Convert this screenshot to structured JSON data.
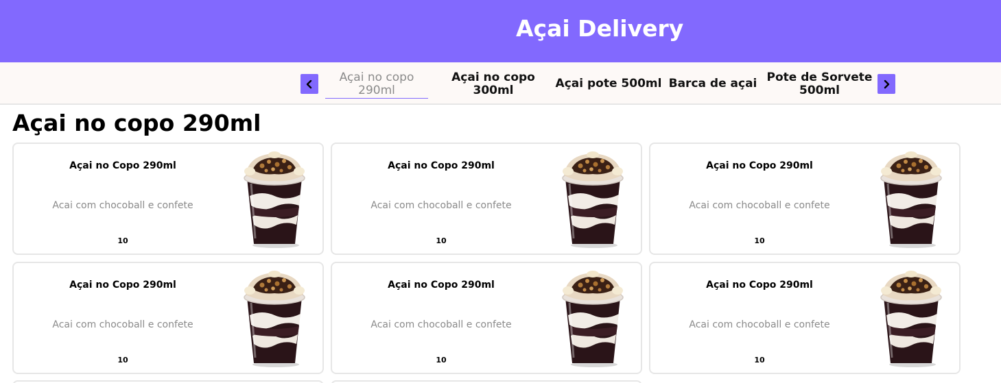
{
  "header": {
    "title": "Açai Delivery"
  },
  "colors": {
    "brand": "#8269fe",
    "muted_text": "#8a8a8a",
    "border": "#e6e6e6"
  },
  "categories": {
    "prev_icon": "chevron-left-icon",
    "next_icon": "chevron-right-icon",
    "tabs": [
      {
        "line1": "Açai no copo",
        "line2": "290ml",
        "active": true
      },
      {
        "line1": "Açai no copo",
        "line2": "300ml",
        "active": false
      },
      {
        "line1": "Açai pote 500ml",
        "line2": "",
        "active": false
      },
      {
        "line1": "Barca de açai",
        "line2": "",
        "active": false
      },
      {
        "line1": "Pote de Sorvete",
        "line2": "500ml",
        "active": false
      }
    ]
  },
  "section": {
    "title": "Açai no copo 290ml"
  },
  "products": [
    {
      "name": "Açai no Copo 290ml",
      "description": "Acai com chocoball e confete",
      "price": "10"
    },
    {
      "name": "Açai no Copo 290ml",
      "description": "Acai com chocoball e confete",
      "price": "10"
    },
    {
      "name": "Açai no Copo 290ml",
      "description": "Acai com chocoball e confete",
      "price": "10"
    },
    {
      "name": "Açai no Copo 290ml",
      "description": "Acai com chocoball e confete",
      "price": "10"
    },
    {
      "name": "Açai no Copo 290ml",
      "description": "Acai com chocoball e confete",
      "price": "10"
    },
    {
      "name": "Açai no Copo 290ml",
      "description": "Acai com chocoball e confete",
      "price": "10"
    }
  ]
}
